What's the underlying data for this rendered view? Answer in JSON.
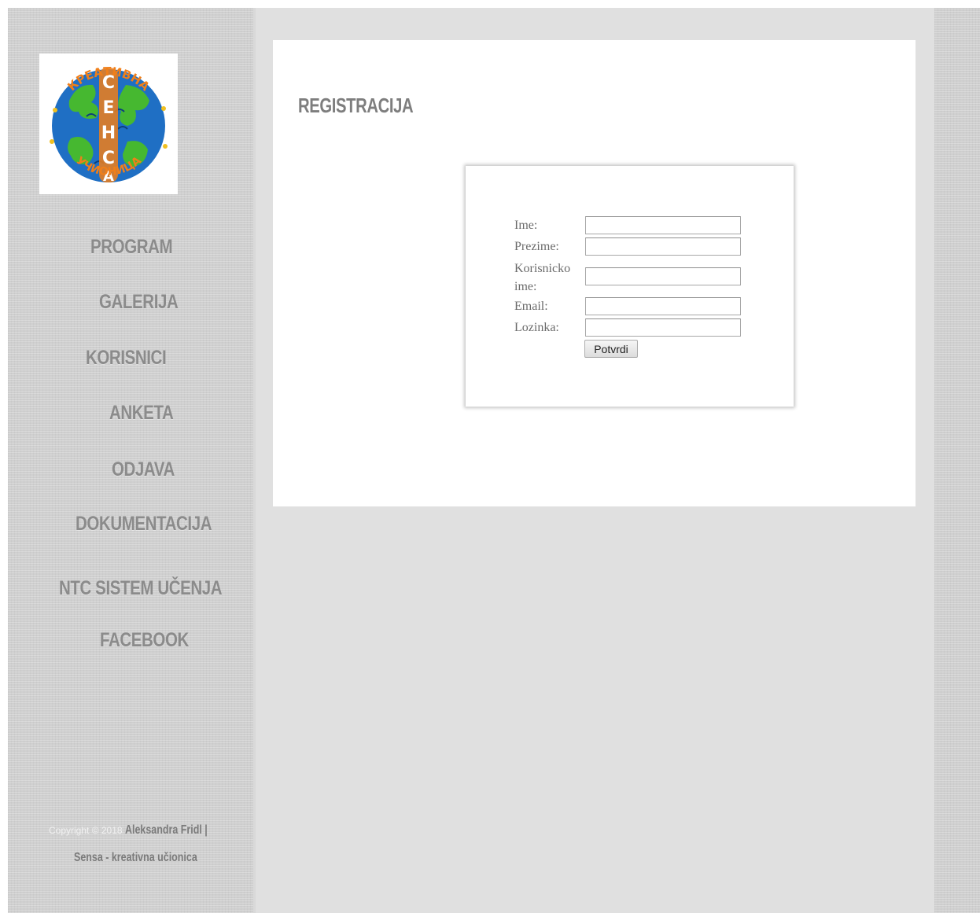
{
  "logo": {
    "arc_top": "КРЕАТИВНА",
    "center": "СЕНСА",
    "arc_bottom": "УЧИОНИЦА"
  },
  "nav": {
    "items": [
      {
        "label": "PROGRAM"
      },
      {
        "label": "GALERIJA"
      },
      {
        "label": "KORISNICI"
      },
      {
        "label": "ANKETA"
      },
      {
        "label": "ODJAVA"
      },
      {
        "label": "DOKUMENTACIJA"
      },
      {
        "label": "NTC SISTEM UČENJA"
      },
      {
        "label": "FACEBOOK"
      }
    ]
  },
  "footer": {
    "copyright": "Copyright © 2018 ",
    "author": "Aleksandra Fridl |",
    "site": "Sensa - kreativna učionica"
  },
  "page": {
    "title": "REGISTRACIJA"
  },
  "form": {
    "fields": [
      {
        "label": "Ime:",
        "value": ""
      },
      {
        "label": "Prezime:",
        "value": ""
      },
      {
        "label": "Korisnicko ime:",
        "value": ""
      },
      {
        "label": "Email:",
        "value": ""
      },
      {
        "label": "Lozinka:",
        "value": ""
      }
    ],
    "submit_label": "Potvrdi"
  },
  "colors": {
    "sidebar_bg": "#cfcfcf",
    "content_bg": "#e0e0e0",
    "nav_text": "#8b8b8b",
    "logo_orange": "#f07f1a",
    "logo_blue": "#1f6fc4",
    "logo_green": "#46b830"
  }
}
